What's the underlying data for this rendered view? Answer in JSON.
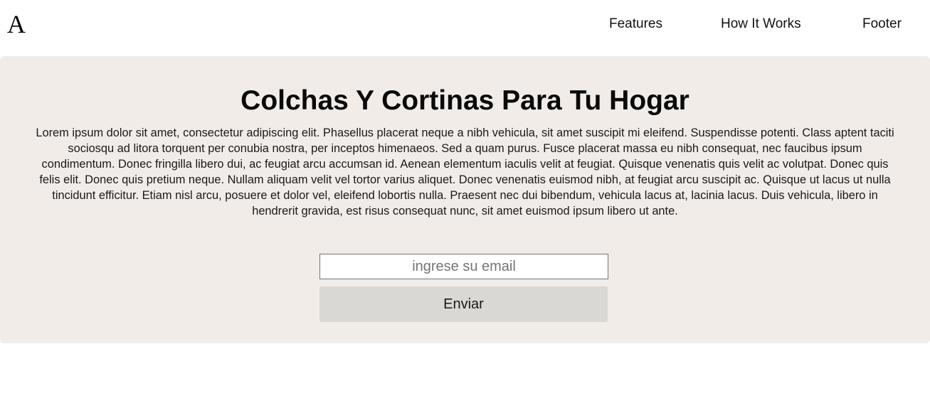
{
  "header": {
    "logo": "A",
    "nav": [
      {
        "label": "Features"
      },
      {
        "label": "How It Works"
      },
      {
        "label": "Footer"
      }
    ]
  },
  "hero": {
    "title": "Colchas Y Cortinas Para Tu Hogar",
    "body": "Lorem ipsum dolor sit amet, consectetur adipiscing elit. Phasellus placerat neque a nibh vehicula, sit amet suscipit mi eleifend. Suspendisse potenti. Class aptent taciti sociosqu ad litora torquent per conubia nostra, per inceptos himenaeos. Sed a quam purus. Fusce placerat massa eu nibh consequat, nec faucibus ipsum condimentum. Donec fringilla libero dui, ac feugiat arcu accumsan id. Aenean elementum iaculis velit at feugiat. Quisque venenatis quis velit ac volutpat. Donec quis felis elit. Donec quis pretium neque. Nullam aliquam velit vel tortor varius aliquet. Donec venenatis euismod nibh, at feugiat arcu suscipit ac. Quisque ut lacus ut nulla tincidunt efficitur. Etiam nisl arcu, posuere et dolor vel, eleifend lobortis nulla. Praesent nec dui bibendum, vehicula lacus at, lacinia lacus. Duis vehicula, libero in hendrerit gravida, est risus consequat nunc, sit amet euismod ipsum libero ut ante.",
    "email": {
      "value": "",
      "placeholder": "ingrese su email"
    },
    "submit_label": "Enviar"
  },
  "colors": {
    "hero_background": "#f1ece8",
    "button_background": "#d9d8d5"
  }
}
